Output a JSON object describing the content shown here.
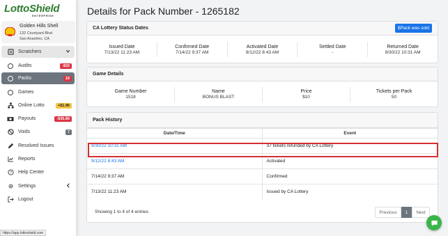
{
  "brand": {
    "name": "LottoShield",
    "sub": "ENTERPRISE"
  },
  "store": {
    "name": "Golden Hills Shell",
    "address1": "132 Courtyard Blvd",
    "address2": "San Anselmo, CA"
  },
  "sidebar": {
    "items": [
      {
        "label": "Scratchers",
        "icon": "ticket-icon"
      },
      {
        "label": "Audits",
        "badge": "-$32",
        "icon": "circle-icon"
      },
      {
        "label": "Packs",
        "badge": "19",
        "icon": "circle-icon"
      },
      {
        "label": "Games",
        "icon": "circle-icon"
      },
      {
        "label": "Online Lotto",
        "badge": "+$1.96",
        "icon": "sitemap-icon"
      },
      {
        "label": "Payouts",
        "badge": "-$35.86",
        "icon": "money-icon"
      },
      {
        "label": "Voids",
        "badge": "7",
        "icon": "ban-icon"
      },
      {
        "label": "Resolved Issues",
        "icon": "pencil-icon"
      },
      {
        "label": "Reports",
        "icon": "chart-icon"
      },
      {
        "label": "Help Center",
        "icon": "question-icon"
      },
      {
        "label": "Settings",
        "icon": "gear-icon"
      },
      {
        "label": "Logout",
        "icon": "logout-icon"
      }
    ]
  },
  "status_url": "https://app.lottoshield.com",
  "page": {
    "title": "Details for Pack Number - 1265182"
  },
  "status_card": {
    "title": "CA Lottery Status Dates",
    "button": "$Pack was sold",
    "cols": [
      {
        "label": "Issued Date",
        "value": "7/13/22 11:23 AM"
      },
      {
        "label": "Confirmed Date",
        "value": "7/14/22 9:37 AM"
      },
      {
        "label": "Activated Date",
        "value": "9/12/22 8:43 AM"
      },
      {
        "label": "Settled Date",
        "value": "-"
      },
      {
        "label": "Returned Date",
        "value": "9/30/22 10:31 AM"
      }
    ]
  },
  "game_card": {
    "title": "Game Details",
    "cols": [
      {
        "label": "Game Number",
        "value": "1518"
      },
      {
        "label": "Name",
        "value": "BONUS BLAST"
      },
      {
        "label": "Price",
        "value": "$10"
      },
      {
        "label": "Tickets per Pack",
        "value": "50"
      }
    ]
  },
  "history": {
    "title": "Pack History",
    "headers": [
      "Date/Time",
      "Event"
    ],
    "rows": [
      {
        "date": "9/30/22 10:31 AM",
        "event": "37 tickets refunded by CA Lottery"
      },
      {
        "date": "9/12/22 8:43 AM",
        "event": "Activated"
      },
      {
        "date": "7/14/22 9:37 AM",
        "event": "Confirmed"
      },
      {
        "date": "7/13/22 11:23 AM",
        "event": "Issued by CA Lottery"
      }
    ],
    "entries_text": "Showing 1 to 4 of 4 entries",
    "pager": {
      "prev": "Previous",
      "current": "1",
      "next": "Next"
    }
  },
  "colors": {
    "accent": "#1a73e8",
    "brand": "#2e7d32",
    "highlight": "#d32f2f",
    "chat": "#3ab54a"
  }
}
